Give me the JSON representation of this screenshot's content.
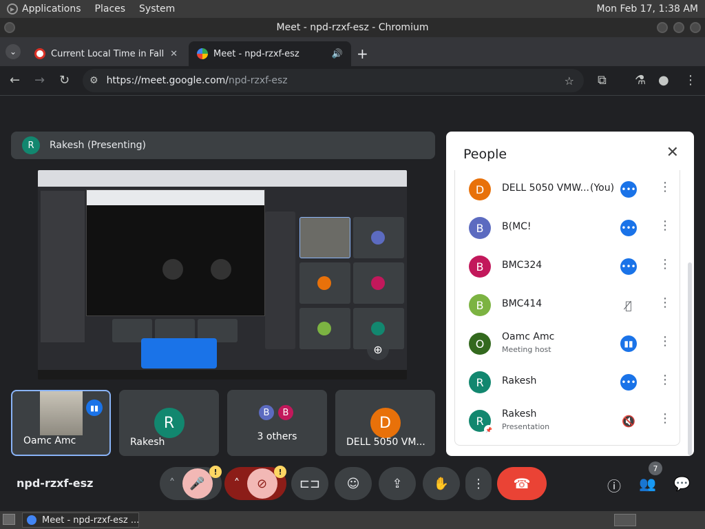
{
  "os": {
    "menus": [
      "Applications",
      "Places",
      "System"
    ],
    "clock": "Mon Feb 17,  1:38 AM"
  },
  "window": {
    "title": "Meet - npd-rzxf-esz - Chromium"
  },
  "tabs": [
    {
      "label": "Current Local Time in Fall Riv",
      "close": "✕"
    },
    {
      "label": "Meet - npd-rzxf-esz",
      "audio_icon": "speaker-icon"
    }
  ],
  "address_bar": {
    "url_host": "https://meet.google.com/",
    "url_path": "npd-rzxf-esz"
  },
  "presenting": {
    "initial": "R",
    "label": "Rakesh (Presenting)"
  },
  "tiles": [
    {
      "name": "Oamc Amc",
      "kind": "camera",
      "speaking": true
    },
    {
      "name": "Rakesh",
      "initial": "R",
      "color": "#12876f"
    },
    {
      "name": "3 others",
      "initials": [
        "B",
        "B"
      ],
      "colors": [
        "#5c6bc0",
        "#c2185b"
      ]
    },
    {
      "name": "DELL 5050 VM...",
      "initial": "D",
      "color": "#e8710a"
    }
  ],
  "people": {
    "title": "People",
    "list": [
      {
        "initial": "D",
        "name": "DELL 5050 VMW...",
        "you": "(You)",
        "color": "#e8710a",
        "status": "more"
      },
      {
        "initial": "B",
        "name": "B(MC!",
        "color": "#5c6bc0",
        "status": "more"
      },
      {
        "initial": "B",
        "name": "BMC324",
        "color": "#c2185b",
        "status": "more"
      },
      {
        "initial": "B",
        "name": "BMC414",
        "color": "#7cb342",
        "status": "mic-off"
      },
      {
        "initial": "O",
        "name": "Oamc Amc",
        "sub": "Meeting host",
        "color": "#33691e",
        "status": "speaking"
      },
      {
        "initial": "R",
        "name": "Rakesh",
        "color": "#12876f",
        "status": "more"
      },
      {
        "initial": "R",
        "name": "Rakesh",
        "sub": "Presentation",
        "color": "#12876f",
        "status": "volume-off"
      }
    ]
  },
  "meeting_code": "npd-rzxf-esz",
  "controls": {
    "warning": "!",
    "people_count": "7"
  },
  "taskbar": {
    "task": "Meet - npd-rzxf-esz ..."
  },
  "colors": {
    "accent": "#1a73e8",
    "end_call": "#ea4335",
    "warning": "#fdd663"
  }
}
